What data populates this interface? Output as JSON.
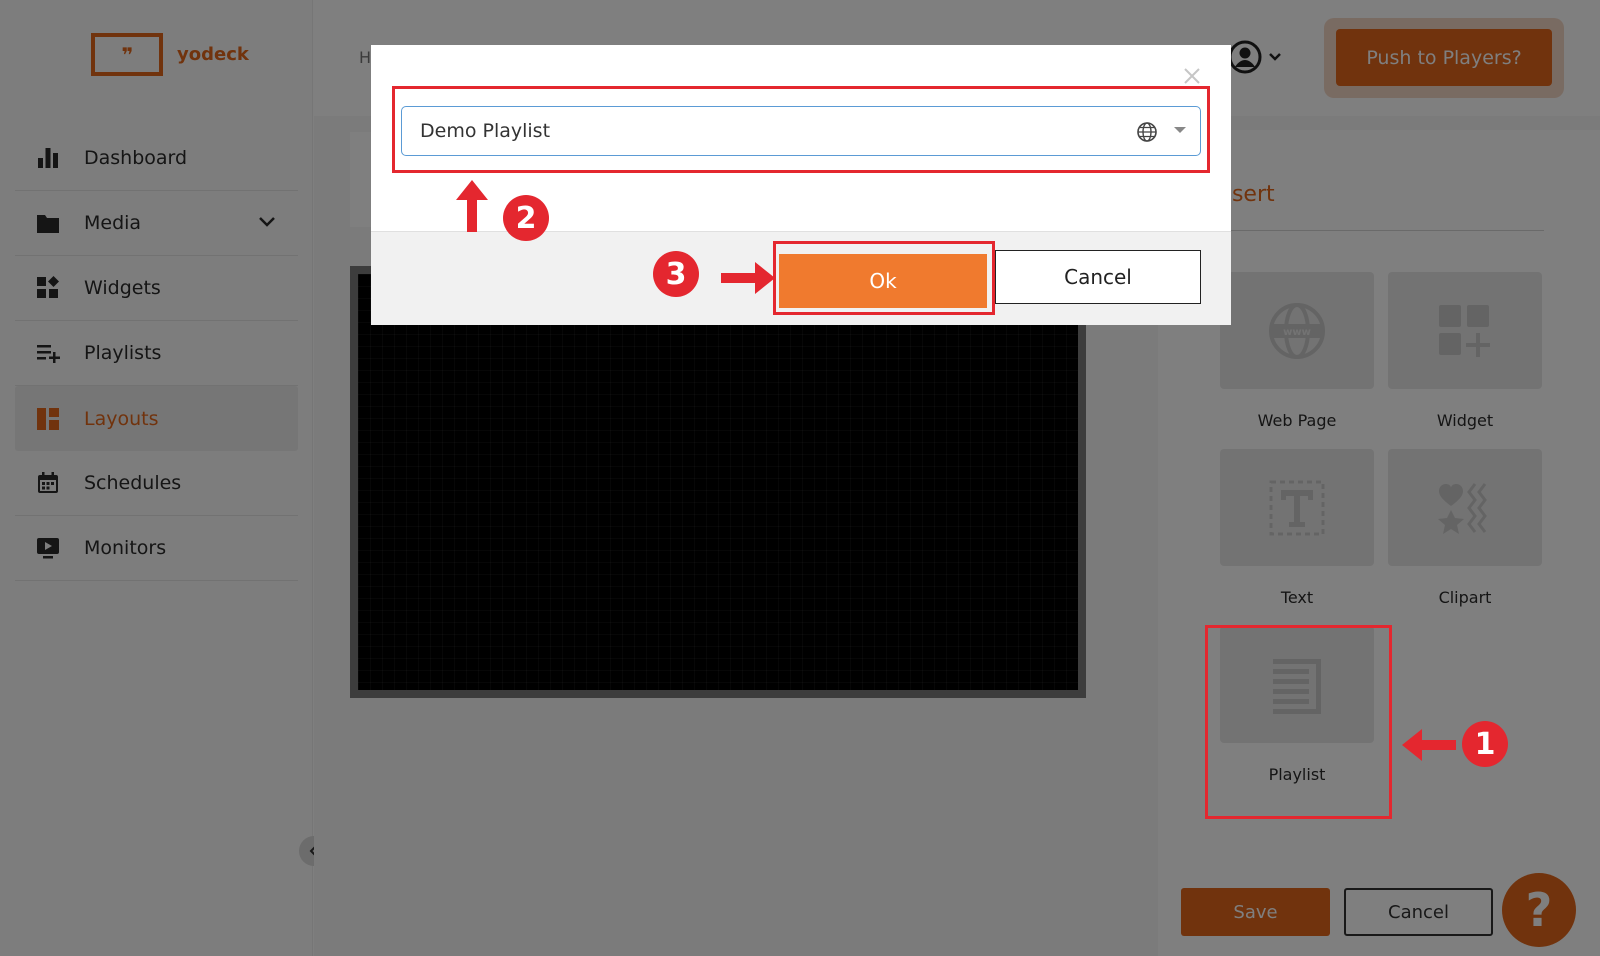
{
  "brand": {
    "name": "yodeck",
    "logo_mark": "❞",
    "accent": "#e2661b"
  },
  "sidebar": {
    "items": [
      {
        "label": "Dashboard",
        "icon": "bar-chart-icon"
      },
      {
        "label": "Media",
        "icon": "folder-icon"
      },
      {
        "label": "Widgets",
        "icon": "widgets-icon"
      },
      {
        "label": "Playlists",
        "icon": "playlist-add-icon"
      },
      {
        "label": "Layouts",
        "icon": "layout-icon"
      },
      {
        "label": "Schedules",
        "icon": "calendar-icon"
      },
      {
        "label": "Monitors",
        "icon": "monitor-play-icon"
      }
    ],
    "active": "Layouts"
  },
  "topbar": {
    "breadcrumb": "H",
    "push_label": "Push to Players?"
  },
  "insert_panel": {
    "title": "nsert",
    "tiles": [
      {
        "label": "Web Page",
        "icon": "www-globe-icon"
      },
      {
        "label": "Widget",
        "icon": "widget-add-icon"
      },
      {
        "label": "Text",
        "icon": "text-icon"
      },
      {
        "label": "Clipart",
        "icon": "clipart-icon"
      },
      {
        "label": "Playlist",
        "icon": "playlist-icon"
      }
    ]
  },
  "footer": {
    "save_label": "Save",
    "cancel_label": "Cancel",
    "help_label": "?"
  },
  "modal": {
    "selected_playlist": "Demo Playlist",
    "ok_label": "Ok",
    "cancel_label": "Cancel"
  },
  "annotations": {
    "step1": "1",
    "step2": "2",
    "step3": "3",
    "color": "#e4272f"
  }
}
